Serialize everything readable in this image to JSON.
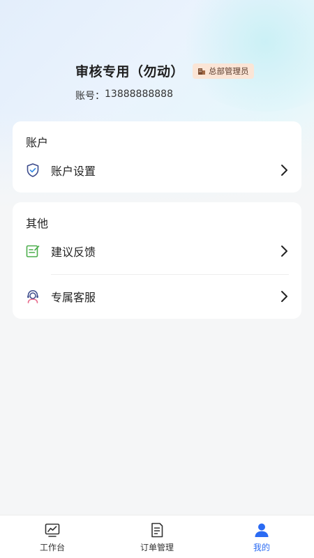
{
  "profile": {
    "name": "审核专用（勿动）",
    "role_badge": "总部管理员",
    "account_label": "账号：",
    "account_number": "13888888888"
  },
  "account_section": {
    "title": "账户",
    "items": [
      {
        "label": "账户设置",
        "icon": "shield-check-icon"
      }
    ]
  },
  "other_section": {
    "title": "其他",
    "items": [
      {
        "label": "建议反馈",
        "icon": "feedback-edit-icon"
      },
      {
        "label": "专属客服",
        "icon": "customer-service-icon"
      }
    ]
  },
  "tabbar": {
    "tabs": [
      {
        "label": "工作台",
        "icon": "dashboard-chart-icon",
        "active": false
      },
      {
        "label": "订单管理",
        "icon": "order-document-icon",
        "active": false
      },
      {
        "label": "我的",
        "icon": "user-icon",
        "active": true
      }
    ]
  },
  "colors": {
    "accent": "#2b6bf3",
    "badge_bg": "#fbe5d6",
    "page_bg": "#f5f6f7"
  }
}
